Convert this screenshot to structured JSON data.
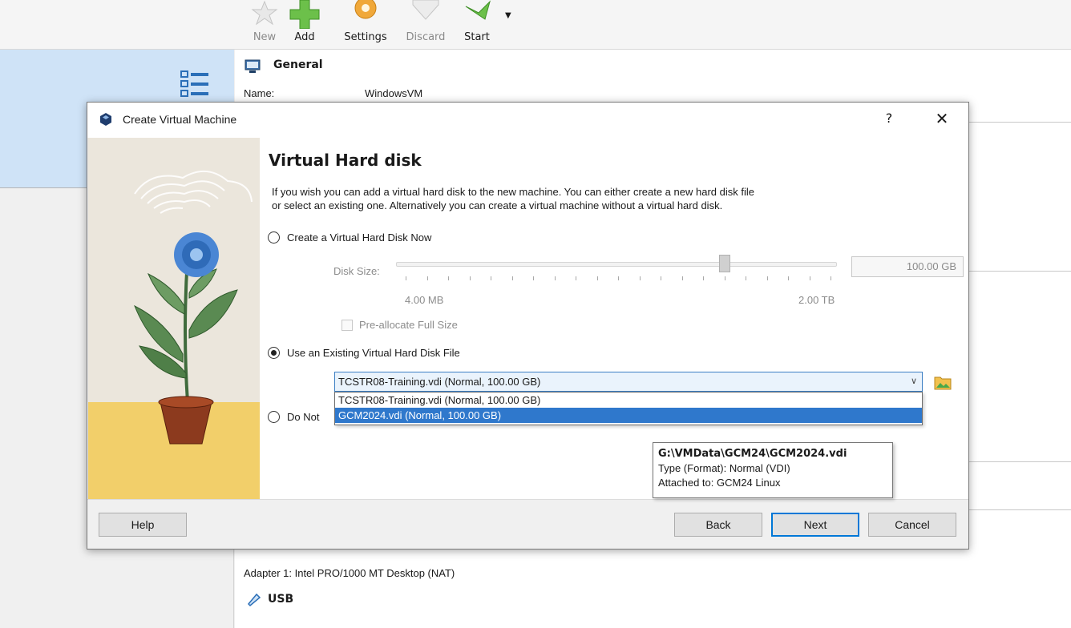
{
  "toolbar": {
    "new_label": "New",
    "add_label": "Add",
    "settings_label": "Settings",
    "discard_label": "Discard",
    "start_label": "Start"
  },
  "details": {
    "general_header": "General",
    "name_label": "Name:",
    "name_value": "WindowsVM",
    "adapter_text": "Adapter 1:  Intel PRO/1000 MT Desktop (NAT)",
    "usb_header": "USB"
  },
  "dialog": {
    "title": "Create Virtual Machine",
    "help_glyph": "?",
    "close_glyph": "✕",
    "page_title": "Virtual Hard disk",
    "description_line1": "If you wish you can add a virtual hard disk to the new machine. You can either create a new hard disk file",
    "description_line2": "or select an existing one. Alternatively you can create a virtual machine without a virtual hard disk.",
    "option_create": "Create a Virtual Hard Disk Now",
    "disk_size_label": "Disk Size:",
    "disk_size_value": "100.00 GB",
    "disk_size_fraction": 0.75,
    "min_size": "4.00 MB",
    "max_size": "2.00 TB",
    "preallocate_label": "Pre-allocate Full Size",
    "option_existing": "Use an Existing Virtual Hard Disk File",
    "option_none_visible": "Do Not",
    "combo_value": "TCSTR08-Training.vdi (Normal, 100.00 GB)",
    "dropdown_options": [
      "TCSTR08-Training.vdi (Normal, 100.00 GB)",
      "GCM2024.vdi (Normal, 100.00 GB)"
    ],
    "tooltip": {
      "path": "G:\\VMData\\GCM24\\GCM2024.vdi",
      "type": "Type (Format):  Normal (VDI)",
      "attached": "Attached to:  GCM24 Linux"
    },
    "buttons": {
      "help": "Help",
      "back": "Back",
      "next": "Next",
      "cancel": "Cancel"
    }
  },
  "colors": {
    "accent": "#0078d7",
    "selection": "#2f78cc",
    "left_selection": "#cfe3f7"
  }
}
